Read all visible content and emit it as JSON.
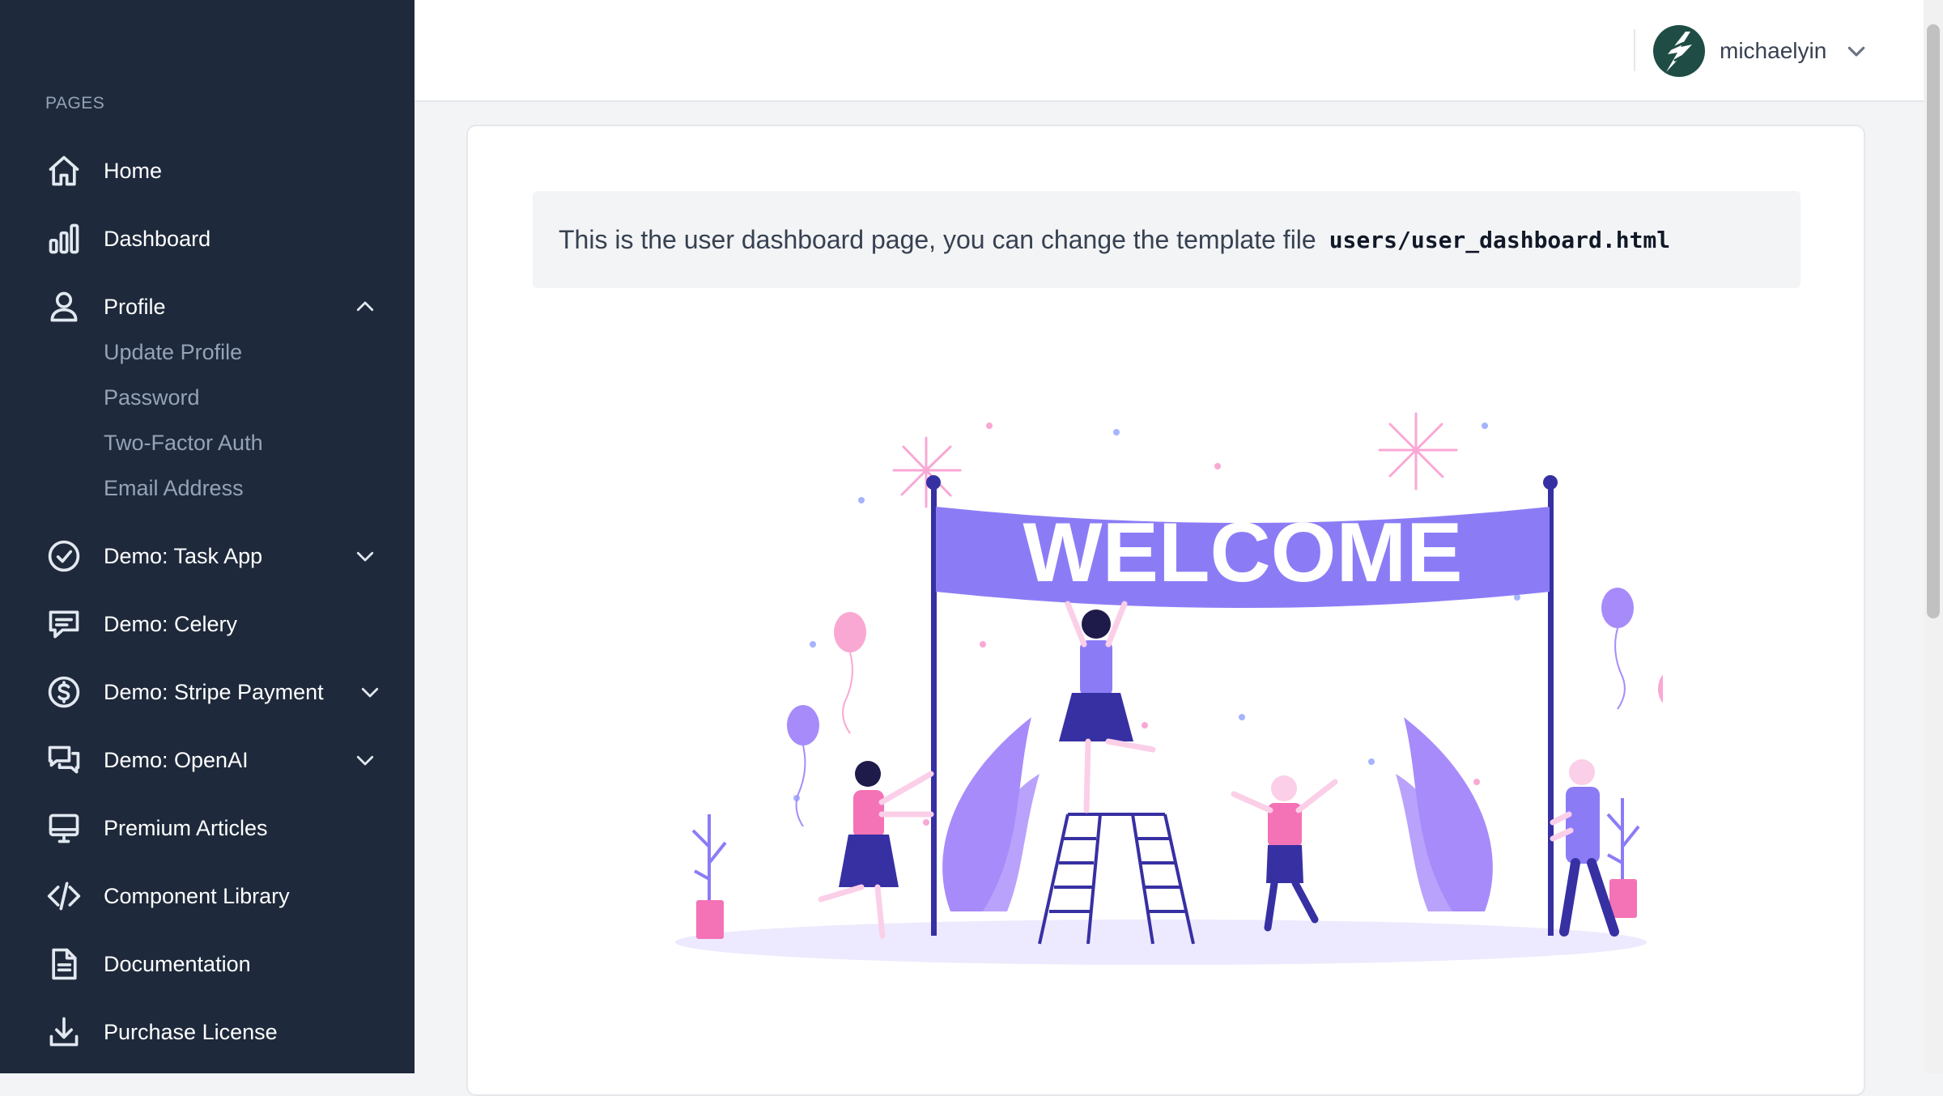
{
  "sidebar": {
    "section_label": "PAGES",
    "items": [
      {
        "label": "Home",
        "icon": "home-icon"
      },
      {
        "label": "Dashboard",
        "icon": "bar-chart-icon"
      },
      {
        "label": "Profile",
        "icon": "user-icon",
        "expanded": true
      },
      {
        "label": "Demo: Task App",
        "icon": "check-circle-icon",
        "expanded": false
      },
      {
        "label": "Demo: Celery",
        "icon": "message-square-icon"
      },
      {
        "label": "Demo: Stripe Payment",
        "icon": "dollar-circle-icon",
        "expanded": false
      },
      {
        "label": "Demo: OpenAI",
        "icon": "chat-bubbles-icon",
        "expanded": false
      },
      {
        "label": "Premium Articles",
        "icon": "monitor-icon"
      },
      {
        "label": "Component Library",
        "icon": "code-icon"
      },
      {
        "label": "Documentation",
        "icon": "file-text-icon"
      },
      {
        "label": "Purchase License",
        "icon": "download-icon"
      }
    ],
    "profile_subitems": [
      "Update Profile",
      "Password",
      "Two-Factor Auth",
      "Email Address"
    ]
  },
  "topbar": {
    "username": "michaelyin",
    "avatar_icon": "lightning-bolt-icon",
    "avatar_color": "#1f4d45"
  },
  "main": {
    "notice_text": "This is the user dashboard page, you can change the template file",
    "notice_code": "users/user_dashboard.html",
    "banner_text": "WELCOME"
  },
  "colors": {
    "sidebar_bg": "#1e293b",
    "accent_purple": "#8b7cf6",
    "accent_pink": "#f472b6"
  }
}
